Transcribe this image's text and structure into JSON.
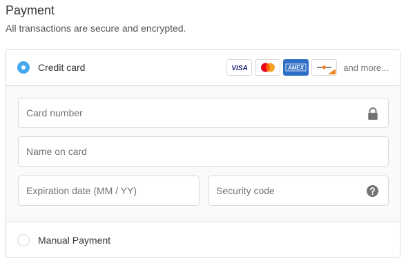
{
  "header": {
    "title": "Payment",
    "subtitle": "All transactions are secure and encrypted."
  },
  "methods": {
    "credit_card": {
      "label": "Credit card",
      "selected": true,
      "brands": [
        {
          "name": "VISA",
          "icon": "visa-icon"
        },
        {
          "name": "Mastercard",
          "icon": "mastercard-icon"
        },
        {
          "name": "AMEX",
          "icon": "amex-icon"
        },
        {
          "name": "Discover",
          "icon": "generic-card-icon"
        }
      ],
      "more_label": "and more..."
    },
    "manual": {
      "label": "Manual Payment",
      "selected": false
    }
  },
  "form": {
    "card_number": {
      "placeholder": "Card number",
      "value": "",
      "icon": "lock-icon"
    },
    "name_on_card": {
      "placeholder": "Name on card",
      "value": ""
    },
    "expiration": {
      "placeholder": "Expiration date (MM / YY)",
      "value": ""
    },
    "security_code": {
      "placeholder": "Security code",
      "value": "",
      "icon": "help-icon"
    }
  },
  "colors": {
    "accent": "#44a9f0",
    "border": "#d9d9d9",
    "form_bg": "#fafafa",
    "amex": "#2f6fc6"
  }
}
